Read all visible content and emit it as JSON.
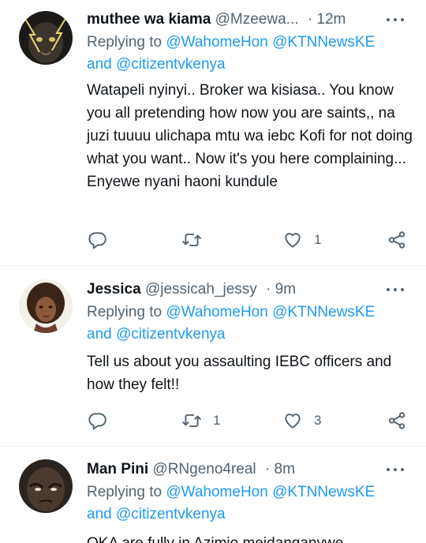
{
  "tweets": [
    {
      "name": "muthee wa kiama",
      "handle": "@Mzeewa...",
      "time": "· 12m",
      "replying_prefix": "Replying to ",
      "replying_user1": "@WahomeHon",
      "replying_user2": "@KTNNewsKE",
      "replying_and": "and ",
      "replying_user3": "@citizentvkenya",
      "text": "Watapeli nyinyi.. Broker wa kisiasa.. You know you all pretending how now you are saints,, na juzi tuuuu ulichapa mtu wa iebc Kofi for not doing what you want.. Now it's you here complaining... Enyewe nyani haoni kundule",
      "retweets": "",
      "likes": "1"
    },
    {
      "name": "Jessica",
      "handle": "@jessicah_jessy",
      "time": "· 9m",
      "replying_prefix": "Replying to ",
      "replying_user1": "@WahomeHon",
      "replying_user2": "@KTNNewsKE",
      "replying_and": "and ",
      "replying_user3": "@citizentvkenya",
      "text": "Tell us about you assaulting IEBC officers and how they felt!!",
      "retweets": "1",
      "likes": "3"
    },
    {
      "name": "Man Pini",
      "handle": "@RNgeno4real",
      "time": "· 8m",
      "replying_prefix": "Replying to ",
      "replying_user1": "@WahomeHon",
      "replying_user2": "@KTNNewsKE",
      "replying_and": "and ",
      "replying_user3": "@citizentvkenya",
      "text": "OKA are fully in Azimio meidanganywe"
    }
  ],
  "colors": {
    "link": "#1d9bf0",
    "muted": "#536471",
    "text": "#0f1419"
  },
  "icons": [
    "reply-icon",
    "retweet-icon",
    "like-icon",
    "share-icon",
    "more-icon"
  ]
}
